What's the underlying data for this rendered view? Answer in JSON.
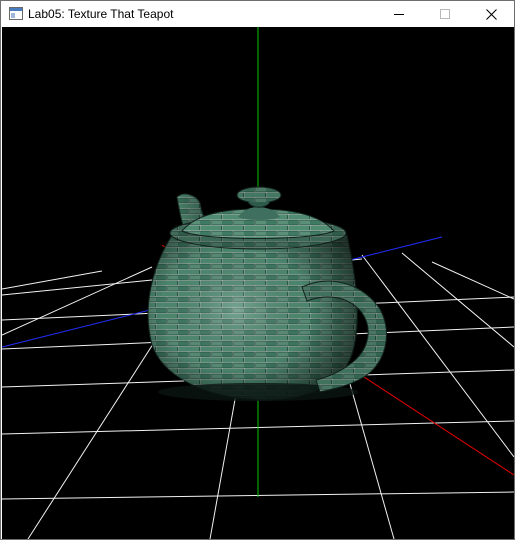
{
  "window": {
    "title": "Lab05: Texture That Teapot",
    "icon": "app-window-icon",
    "controls": {
      "minimize": "minimize-icon",
      "maximize": "maximize-icon",
      "close": "close-icon"
    }
  },
  "scene": {
    "background": "#000000",
    "grid_color": "#ffffff",
    "axis_colors": {
      "x": "#ff0000",
      "y": "#00ff00",
      "z": "#2222ff"
    },
    "object": "brick-textured teapot"
  }
}
